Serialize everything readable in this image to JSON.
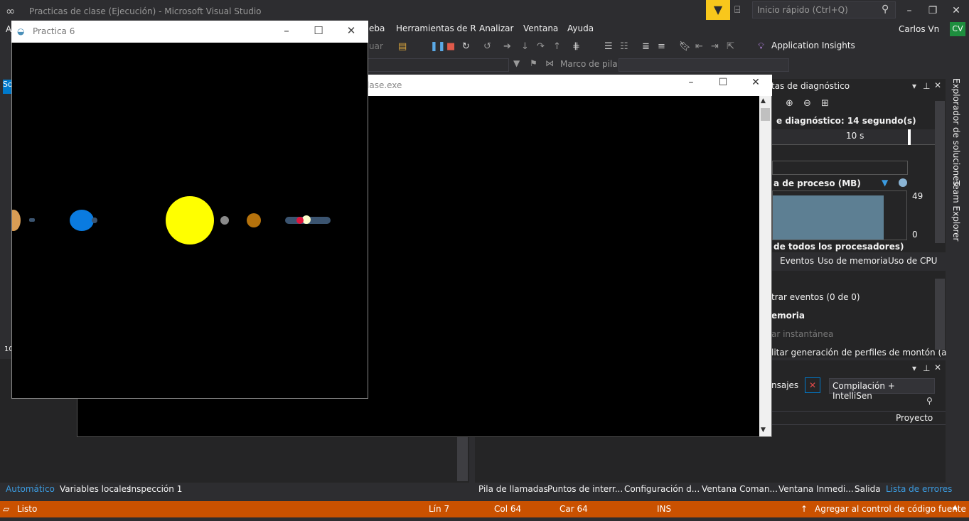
{
  "vs": {
    "title": "Practicas de clase (Ejecución) - Microsoft Visual Studio",
    "quick_launch": "Inicio rápido (Ctrl+Q)",
    "user": "Carlos Vn",
    "avatar": "CV",
    "menu": [
      "A",
      "eba",
      "Herramientas de R",
      "Analizar",
      "Ventana",
      "Ayuda"
    ],
    "toolbar": {
      "dd_suffix": "uar",
      "application_insights": "Application Insights",
      "stack_label": "Marco de pila:"
    }
  },
  "diag": {
    "header": "tas de diagnóstico",
    "session": "e diagnóstico: 14 segundo(s)",
    "tick": "10 s",
    "mem_title": "a de proceso (MB)",
    "mem_max": "49",
    "mem_min": "0",
    "cpu": "de todos los procesadores)",
    "tabs": [
      "Eventos",
      "Uso de memoria",
      "Uso de CPU"
    ],
    "events_filter": "trar eventos (0 de 0)",
    "memory_section": "emoria",
    "snapshot": "ar instantánea",
    "heap": "litar generación de perfiles de montón (a"
  },
  "errors": {
    "messages": "nsajes",
    "build_filter": "Compilación + IntelliSen",
    "project_col": "Proyecto"
  },
  "side_tabs": [
    "Explorador de soluciones",
    "Team Explorer"
  ],
  "left_labels": {
    "sol": "So",
    "num": "10",
    "a": "A"
  },
  "bottom_tabs_left": [
    "Automático",
    "Variables locales",
    "Inspección 1"
  ],
  "bottom_tabs_right": [
    "Pila de llamadas",
    "Puntos de interr...",
    "Configuración d...",
    "Ventana Coman...",
    "Ventana Inmedi...",
    "Salida",
    "Lista de errores"
  ],
  "status": {
    "ready": "Listo",
    "line": "Lín 7",
    "col": "Col 64",
    "car": "Car 64",
    "ins": "INS",
    "source_control": "Agregar al control de código fuente"
  },
  "console": {
    "title": "lase.exe"
  },
  "practica": {
    "title": "Practica 6"
  },
  "colors": {
    "status": "#ca5100",
    "accent": "#007acc",
    "sun": "#ffff00",
    "earth": "#0a7be0"
  }
}
